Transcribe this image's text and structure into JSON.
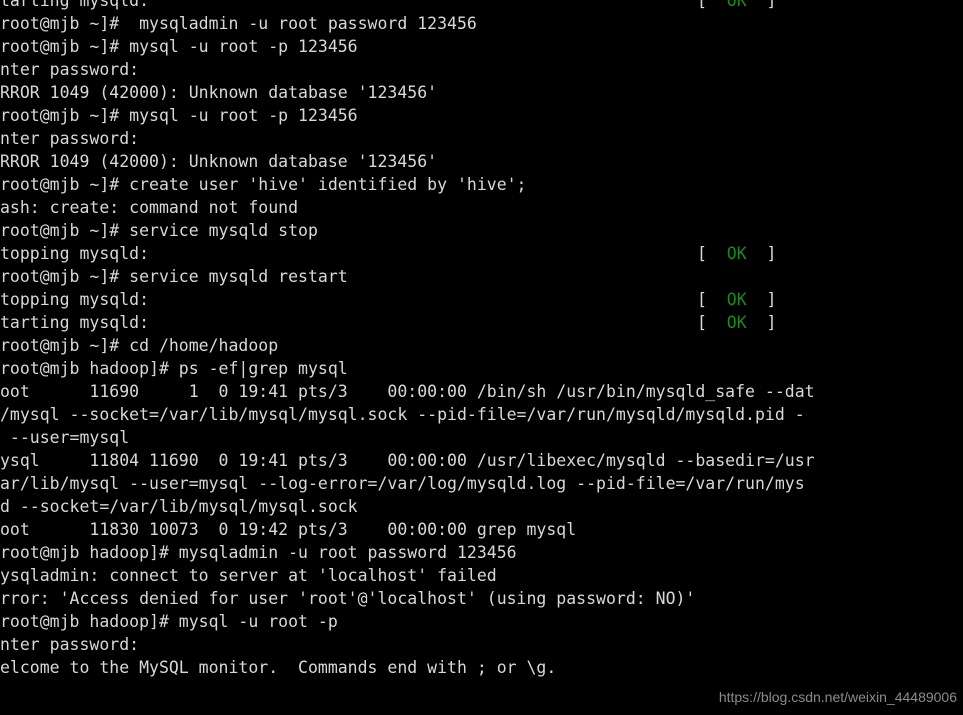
{
  "terminal": {
    "background_color": "#000000",
    "foreground_color": "#d8d8d8",
    "ok_color": "#1a8a1a",
    "bracket_color": "#d8d8d8",
    "status_ok": "[  OK  ]",
    "lines": [
      {
        "text": "tarting mysqld:",
        "status": "[  OK  ]"
      },
      {
        "text": "root@mjb ~]#  mysqladmin -u root password 123456",
        "status": ""
      },
      {
        "text": "root@mjb ~]# mysql -u root -p 123456",
        "status": ""
      },
      {
        "text": "nter password:",
        "status": ""
      },
      {
        "text": "RROR 1049 (42000): Unknown database '123456'",
        "status": ""
      },
      {
        "text": "root@mjb ~]# mysql -u root -p 123456",
        "status": ""
      },
      {
        "text": "nter password:",
        "status": ""
      },
      {
        "text": "RROR 1049 (42000): Unknown database '123456'",
        "status": ""
      },
      {
        "text": "root@mjb ~]# create user 'hive' identified by 'hive';",
        "status": ""
      },
      {
        "text": "ash: create: command not found",
        "status": ""
      },
      {
        "text": "root@mjb ~]# service mysqld stop",
        "status": ""
      },
      {
        "text": "topping mysqld:",
        "status": "[  OK  ]"
      },
      {
        "text": "root@mjb ~]# service mysqld restart",
        "status": ""
      },
      {
        "text": "topping mysqld:",
        "status": "[  OK  ]"
      },
      {
        "text": "tarting mysqld:",
        "status": "[  OK  ]"
      },
      {
        "text": "root@mjb ~]# cd /home/hadoop",
        "status": ""
      },
      {
        "text": "root@mjb hadoop]# ps -ef|grep mysql",
        "status": ""
      },
      {
        "text": "oot      11690     1  0 19:41 pts/3    00:00:00 /bin/sh /usr/bin/mysqld_safe --dat",
        "status": ""
      },
      {
        "text": "/mysql --socket=/var/lib/mysql/mysql.sock --pid-file=/var/run/mysqld/mysqld.pid -",
        "status": ""
      },
      {
        "text": " --user=mysql",
        "status": ""
      },
      {
        "text": "ysql     11804 11690  0 19:41 pts/3    00:00:00 /usr/libexec/mysqld --basedir=/usr",
        "status": ""
      },
      {
        "text": "ar/lib/mysql --user=mysql --log-error=/var/log/mysqld.log --pid-file=/var/run/mys",
        "status": ""
      },
      {
        "text": "d --socket=/var/lib/mysql/mysql.sock",
        "status": ""
      },
      {
        "text": "oot      11830 10073  0 19:42 pts/3    00:00:00 grep mysql",
        "status": ""
      },
      {
        "text": "root@mjb hadoop]# mysqladmin -u root password 123456",
        "status": ""
      },
      {
        "text": "ysqladmin: connect to server at 'localhost' failed",
        "status": ""
      },
      {
        "text": "rror: 'Access denied for user 'root'@'localhost' (using password: NO)'",
        "status": ""
      },
      {
        "text": "root@mjb hadoop]# mysql -u root -p",
        "status": ""
      },
      {
        "text": "nter password:",
        "status": ""
      },
      {
        "text": "elcome to the MySQL monitor.  Commands end with ; or \\g.",
        "status": ""
      }
    ]
  },
  "watermark": {
    "text": "https://blog.csdn.net/weixin_44489006",
    "color": "#8c8c8c"
  }
}
